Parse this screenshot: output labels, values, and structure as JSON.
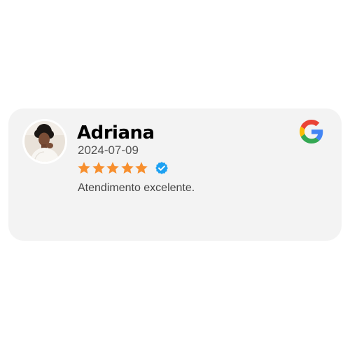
{
  "review": {
    "reviewer_name": "Adriana",
    "date": "2024-07-09",
    "rating": 5,
    "rating_max": 5,
    "verified": true,
    "text": "Atendimento excelente.",
    "source": "Google"
  },
  "icons": {
    "avatar": "avatar",
    "star": "star-icon",
    "verified": "verified-badge-icon",
    "source_logo": "google-logo-icon"
  },
  "colors": {
    "card_background": "#f3f3f3",
    "star": "#f78f2e",
    "verified_badge": "#1da1f2",
    "name": "#000000",
    "date": "#555555",
    "review_text": "#444444"
  }
}
